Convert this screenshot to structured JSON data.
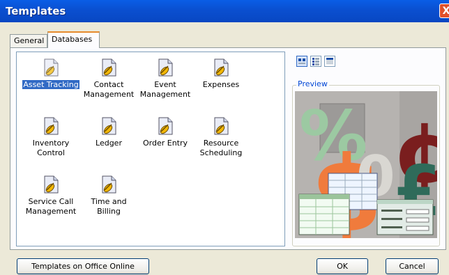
{
  "window": {
    "title": "Templates",
    "close_glyph": "X"
  },
  "tabs": [
    {
      "label": "General",
      "active": false
    },
    {
      "label": "Databases",
      "active": true
    }
  ],
  "templates": [
    {
      "label": "Asset Tracking",
      "selected": true
    },
    {
      "label": "Contact Management",
      "selected": false
    },
    {
      "label": "Event Management",
      "selected": false
    },
    {
      "label": "Expenses",
      "selected": false
    },
    {
      "label": "Inventory Control",
      "selected": false
    },
    {
      "label": "Ledger",
      "selected": false
    },
    {
      "label": "Order Entry",
      "selected": false
    },
    {
      "label": "Resource Scheduling",
      "selected": false
    },
    {
      "label": "Service Call Management",
      "selected": false
    },
    {
      "label": "Time and Billing",
      "selected": false
    }
  ],
  "view_buttons": [
    {
      "icon": "large-icons-view-icon",
      "active": true
    },
    {
      "icon": "list-view-icon",
      "active": false
    },
    {
      "icon": "details-view-icon",
      "active": false
    }
  ],
  "preview": {
    "label": "Preview"
  },
  "buttons": {
    "online": "Templates on Office Online",
    "ok": "OK",
    "cancel": "Cancel"
  },
  "colors": {
    "title_bar": "#0a4fd0",
    "selection": "#316ac5",
    "tab_highlight": "#e68b2c"
  }
}
